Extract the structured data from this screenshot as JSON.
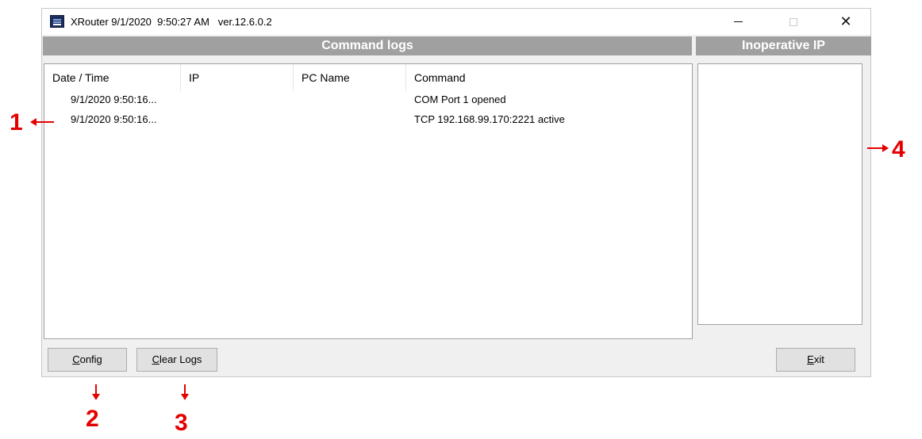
{
  "window": {
    "title": "XRouter 9/1/2020  9:50:27 AM   ver.12.6.0.2",
    "controls": {
      "minimize": "—",
      "maximize": "□",
      "close": "✕"
    }
  },
  "command_logs": {
    "header": "Command logs",
    "columns": [
      "Date / Time",
      "IP",
      "PC Name",
      "Command"
    ],
    "rows": [
      {
        "datetime": "9/1/2020 9:50:16...",
        "ip": "",
        "pc_name": "",
        "command": "COM Port 1 opened"
      },
      {
        "datetime": "9/1/2020 9:50:16...",
        "ip": "",
        "pc_name": "",
        "command": "TCP 192.168.99.170:2221 active"
      }
    ]
  },
  "inoperative_ip": {
    "header": "Inoperative IP",
    "items": []
  },
  "buttons": {
    "config": {
      "mnemonic": "C",
      "rest": "onfig"
    },
    "clear_logs": {
      "mnemonic": "C",
      "rest": "lear Logs"
    },
    "exit": {
      "mnemonic": "E",
      "rest": "xit"
    }
  },
  "annotations": {
    "a1": "1",
    "a2": "2",
    "a3": "3",
    "a4": "4"
  },
  "colors": {
    "accent": "#e50000",
    "header_bg": "#a0a0a0",
    "window_bg": "#f0f0f0"
  }
}
